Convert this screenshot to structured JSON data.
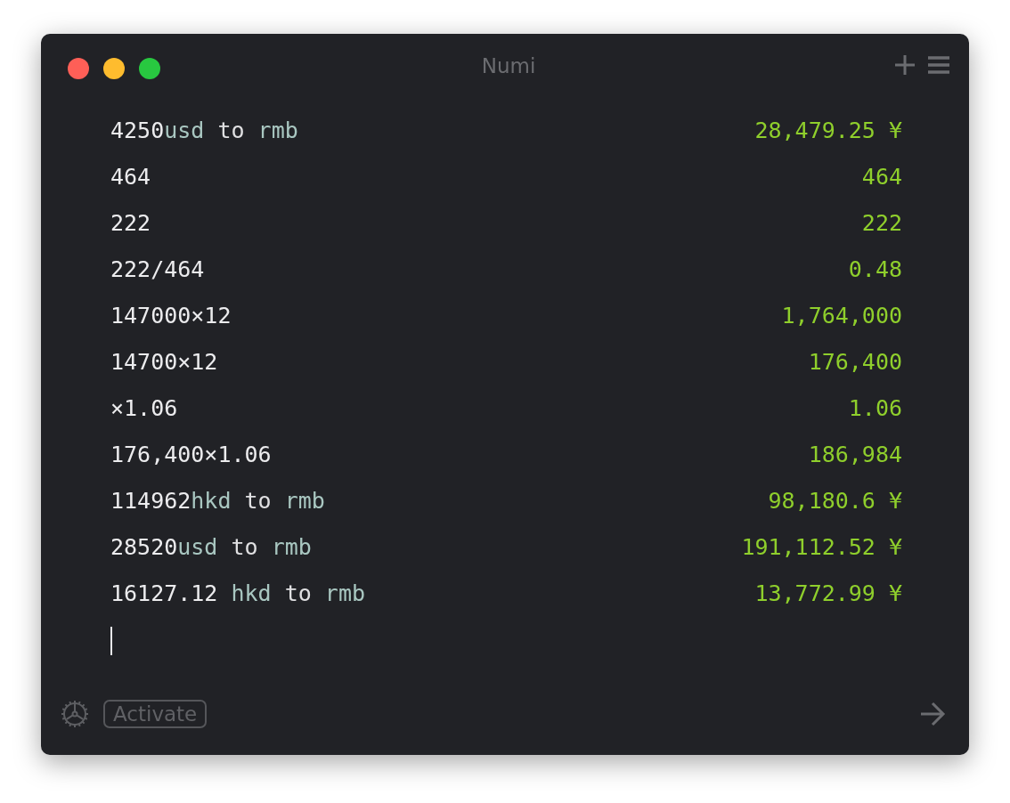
{
  "window": {
    "title": "Numi"
  },
  "lines": [
    {
      "expression": [
        {
          "text": "4250",
          "kind": "number"
        },
        {
          "text": "usd",
          "kind": "unit"
        },
        {
          "text": " to ",
          "kind": "keyword"
        },
        {
          "text": "rmb",
          "kind": "unit"
        }
      ],
      "result": "28,479.25 ¥"
    },
    {
      "expression": [
        {
          "text": "464",
          "kind": "number"
        }
      ],
      "result": "464"
    },
    {
      "expression": [
        {
          "text": "222",
          "kind": "number"
        }
      ],
      "result": "222"
    },
    {
      "expression": [
        {
          "text": "222/464",
          "kind": "number"
        }
      ],
      "result": "0.48"
    },
    {
      "expression": [
        {
          "text": "147000×12",
          "kind": "number"
        }
      ],
      "result": "1,764,000"
    },
    {
      "expression": [
        {
          "text": "14700×12",
          "kind": "number"
        }
      ],
      "result": "176,400"
    },
    {
      "expression": [
        {
          "text": "×1.06",
          "kind": "number"
        }
      ],
      "result": "1.06"
    },
    {
      "expression": [
        {
          "text": "176,400×1.06",
          "kind": "number"
        }
      ],
      "result": "186,984"
    },
    {
      "expression": [
        {
          "text": "114962",
          "kind": "number"
        },
        {
          "text": "hkd",
          "kind": "unit"
        },
        {
          "text": " to ",
          "kind": "keyword"
        },
        {
          "text": "rmb",
          "kind": "unit"
        }
      ],
      "result": "98,180.6 ¥"
    },
    {
      "expression": [
        {
          "text": "28520",
          "kind": "number"
        },
        {
          "text": "usd",
          "kind": "unit"
        },
        {
          "text": " to ",
          "kind": "keyword"
        },
        {
          "text": "rmb",
          "kind": "unit"
        }
      ],
      "result": "191,112.52 ¥"
    },
    {
      "expression": [
        {
          "text": "16127.12 ",
          "kind": "number"
        },
        {
          "text": "hkd",
          "kind": "unit"
        },
        {
          "text": " to ",
          "kind": "keyword"
        },
        {
          "text": "rmb",
          "kind": "unit"
        }
      ],
      "result": "13,772.99 ¥"
    }
  ],
  "footer": {
    "activate_button": "Activate"
  }
}
